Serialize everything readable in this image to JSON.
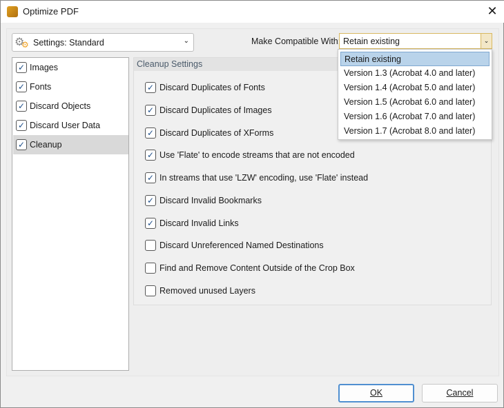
{
  "window": {
    "title": "Optimize PDF",
    "close": "✕"
  },
  "settings": {
    "label": "Settings:  Standard",
    "chevron": "⌄"
  },
  "compat": {
    "label": "Make Compatible With:",
    "value": "Retain existing",
    "arrow": "⌄",
    "options": [
      "Retain existing",
      "Version 1.3 (Acrobat 4.0 and later)",
      "Version 1.4 (Acrobat 5.0 and later)",
      "Version 1.5 (Acrobat 6.0 and later)",
      "Version 1.6 (Acrobat 7.0 and later)",
      "Version 1.7 (Acrobat 8.0 and later)"
    ]
  },
  "sidebar": {
    "items": [
      {
        "label": "Images",
        "checked": true
      },
      {
        "label": "Fonts",
        "checked": true
      },
      {
        "label": "Discard Objects",
        "checked": true
      },
      {
        "label": "Discard User Data",
        "checked": true
      },
      {
        "label": "Cleanup",
        "checked": true
      }
    ]
  },
  "cleanup": {
    "title": "Cleanup Settings",
    "options": [
      {
        "label": "Discard Duplicates of Fonts",
        "checked": true
      },
      {
        "label": "Discard Duplicates of Images",
        "checked": true
      },
      {
        "label": "Discard Duplicates of XForms",
        "checked": true
      },
      {
        "label": "Use 'Flate' to encode streams that are not encoded",
        "checked": true
      },
      {
        "label": "In streams that use 'LZW' encoding, use 'Flate' instead",
        "checked": true
      },
      {
        "label": "Discard Invalid Bookmarks",
        "checked": true
      },
      {
        "label": "Discard Invalid Links",
        "checked": true
      },
      {
        "label": "Discard Unreferenced Named Destinations",
        "checked": false
      },
      {
        "label": "Find and Remove Content Outside of the Crop Box",
        "checked": false
      },
      {
        "label": "Removed unused Layers",
        "checked": false
      }
    ]
  },
  "buttons": {
    "ok": "OK",
    "cancel": "Cancel"
  },
  "check": "✓"
}
